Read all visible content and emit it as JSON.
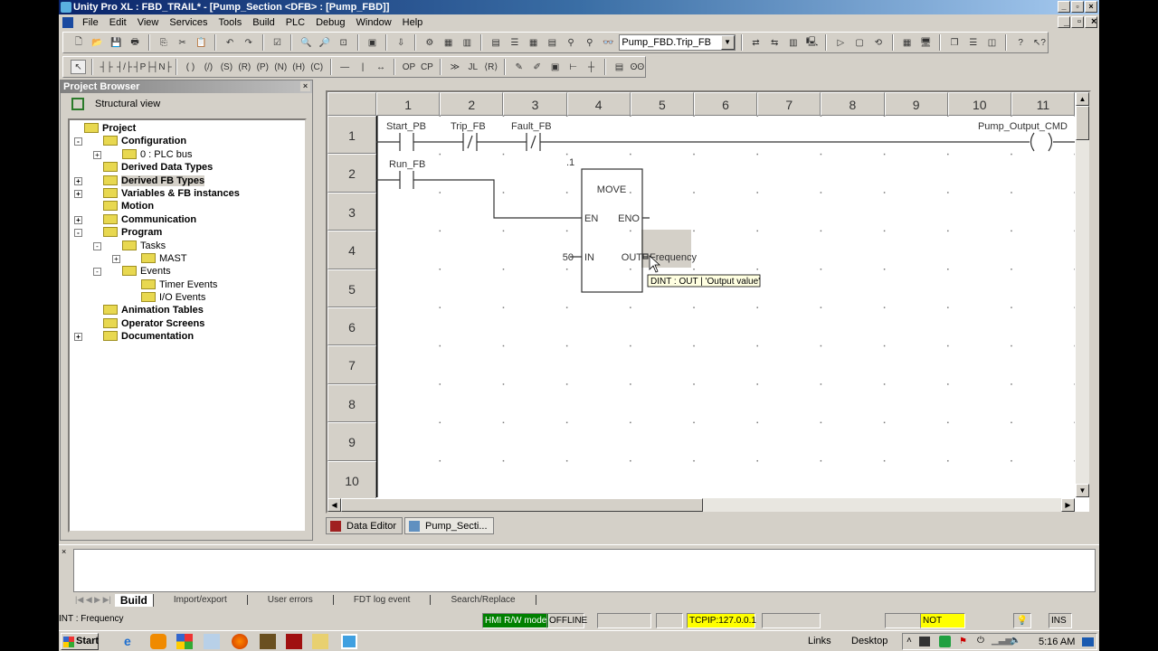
{
  "window": {
    "title": "Unity Pro XL : FBD_TRAIL* - [Pump_Section <DFB> : [Pump_FBD]]"
  },
  "menu": [
    "File",
    "Edit",
    "View",
    "Services",
    "Tools",
    "Build",
    "PLC",
    "Debug",
    "Window",
    "Help"
  ],
  "toolbar": {
    "search_value": "Pump_FBD.Trip_FB"
  },
  "project_browser": {
    "title": "Project Browser",
    "view_label": "Structural view",
    "tree": [
      {
        "label": "Project",
        "level": 0,
        "bold": true,
        "pm": ""
      },
      {
        "label": "Configuration",
        "level": 1,
        "bold": true,
        "pm": "-"
      },
      {
        "label": "0 : PLC bus",
        "level": 2,
        "bold": false,
        "pm": "+"
      },
      {
        "label": "Derived Data Types",
        "level": 1,
        "bold": true,
        "pm": ""
      },
      {
        "label": "Derived FB Types",
        "level": 1,
        "bold": true,
        "pm": "+",
        "selected": true
      },
      {
        "label": "Variables & FB instances",
        "level": 1,
        "bold": true,
        "pm": "+"
      },
      {
        "label": "Motion",
        "level": 1,
        "bold": true,
        "pm": ""
      },
      {
        "label": "Communication",
        "level": 1,
        "bold": true,
        "pm": "+"
      },
      {
        "label": "Program",
        "level": 1,
        "bold": true,
        "pm": "-"
      },
      {
        "label": "Tasks",
        "level": 2,
        "bold": false,
        "pm": "-"
      },
      {
        "label": "MAST",
        "level": 3,
        "bold": false,
        "pm": "+"
      },
      {
        "label": "Events",
        "level": 2,
        "bold": false,
        "pm": "-"
      },
      {
        "label": "Timer Events",
        "level": 3,
        "bold": false,
        "pm": ""
      },
      {
        "label": "I/O Events",
        "level": 3,
        "bold": false,
        "pm": ""
      },
      {
        "label": "Animation Tables",
        "level": 1,
        "bold": true,
        "pm": ""
      },
      {
        "label": "Operator Screens",
        "level": 1,
        "bold": true,
        "pm": ""
      },
      {
        "label": "Documentation",
        "level": 1,
        "bold": true,
        "pm": "+"
      }
    ]
  },
  "editor": {
    "columns": [
      "1",
      "2",
      "3",
      "4",
      "5",
      "6",
      "7",
      "8",
      "9",
      "10",
      "11"
    ],
    "rows": [
      "1",
      "2",
      "3",
      "4",
      "5",
      "6",
      "7",
      "8",
      "9",
      "10"
    ],
    "ladder": {
      "contact1": "Start_PB",
      "contact2": "Trip_FB",
      "contact3": "Fault_FB",
      "coil": "Pump_Output_CMD",
      "contact4": "Run_FB",
      "block_instance": ".1",
      "block_name": "MOVE",
      "pin_en": "EN",
      "pin_eno": "ENO",
      "pin_in": "IN",
      "pin_out": "OUT",
      "in_value": "50",
      "out_var": "Frequency",
      "tooltip": "DINT : OUT | 'Output value'"
    }
  },
  "doc_tabs": [
    "Data Editor",
    "Pump_Secti..."
  ],
  "output_tabs": [
    "Build",
    "Import/export",
    "User errors",
    "FDT log event",
    "Search/Replace"
  ],
  "status": {
    "message": "INT : Frequency",
    "hmi": "HMI R/W mode",
    "mode": "OFFLINE",
    "address": "TCPIP:127.0.0.1",
    "build": "NOT BUILT",
    "ins": "INS"
  },
  "taskbar": {
    "start": "Start",
    "links": "Links",
    "desktop": "Desktop",
    "clock": "5:16 AM"
  },
  "colors": {
    "title": "#0a246a",
    "hmi": "#008000",
    "highlight": "#ffff00"
  }
}
